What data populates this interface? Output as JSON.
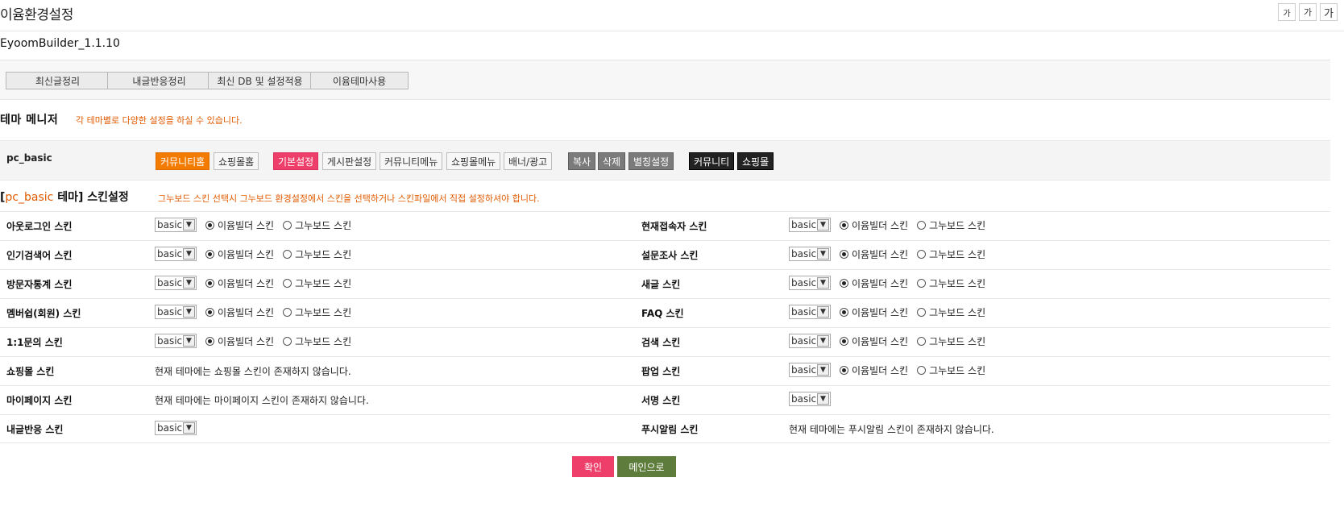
{
  "header": {
    "title": "이윰환경설정",
    "font_size_buttons": [
      "가",
      "가",
      "가"
    ]
  },
  "version": "EyoomBuilder_1.1.10",
  "toolbar": {
    "buttons": [
      "최신글정리",
      "내글반응정리",
      "최신 DB 및 설정적용",
      "이윰테마사용"
    ]
  },
  "theme_manager": {
    "title": "테마 메니저",
    "note": "각 테마별로 다양한 설정을 하실 수 있습니다.",
    "theme_name": "pc_basic",
    "buttons": [
      "커뮤니티홈",
      "쇼핑몰홈",
      "기본설정",
      "게시판설정",
      "커뮤니티메뉴",
      "쇼핑몰메뉴",
      "배너/광고",
      "복사",
      "삭제",
      "별칭설정",
      "커뮤니티",
      "쇼핑몰"
    ]
  },
  "skin_settings": {
    "title_open": "[",
    "title_theme": "pc_basic",
    "title_rest": " 테마] 스킨설정",
    "note": "그누보드 스킨 선택시 그누보드 환경설정에서 스킨을 선택하거나 스킨파일에서 직접 설정하셔야 합니다.",
    "select_value": "basic",
    "radio_eyoom": "이윰빌더 스킨",
    "radio_gnu": "그누보드 스킨",
    "left": [
      {
        "label": "아웃로그인 스킨"
      },
      {
        "label": "인기검색어 스킨"
      },
      {
        "label": "방문자통계 스킨"
      },
      {
        "label": "멤버쉽(회원) 스킨"
      },
      {
        "label": "1:1문의 스킨"
      },
      {
        "label": "쇼핑몰 스킨",
        "message": "현재 테마에는 쇼핑몰 스킨이 존재하지 않습니다."
      },
      {
        "label": "마이페이지 스킨",
        "message": "현재 테마에는 마이페이지 스킨이 존재하지 않습니다."
      },
      {
        "label": "내글반응 스킨"
      }
    ],
    "right": [
      {
        "label": "현재접속자 스킨"
      },
      {
        "label": "설문조사 스킨"
      },
      {
        "label": "새글 스킨"
      },
      {
        "label": "FAQ 스킨"
      },
      {
        "label": "검색 스킨"
      },
      {
        "label": "팝업 스킨"
      },
      {
        "label": "서명 스킨"
      },
      {
        "label": "푸시알림 스킨",
        "message": "현재 테마에는 푸시알림 스킨이 존재하지 않습니다."
      }
    ]
  },
  "actions": {
    "confirm": "확인",
    "main": "메인으로"
  }
}
